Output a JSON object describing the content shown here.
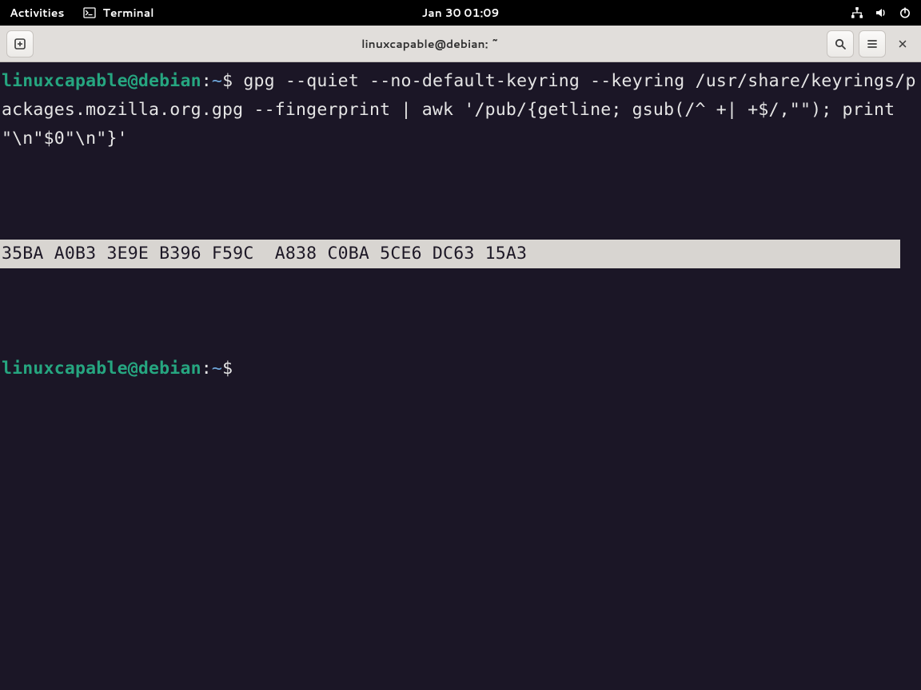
{
  "top_panel": {
    "activities": "Activities",
    "app_label": "Terminal",
    "clock": "Jan 30  01:09"
  },
  "titlebar": {
    "title": "linuxcapable@debian: ~"
  },
  "terminal": {
    "prompt_user": "linuxcapable@debian",
    "prompt_sep": ":",
    "prompt_path": "~",
    "prompt_symbol": "$",
    "command": "gpg --quiet --no-default-keyring --keyring /usr/share/keyrings/packages.mozilla.org.gpg --fingerprint | awk '/pub/{getline; gsub(/^ +| +$/,\"\"); print \"\\n\"$0\"\\n\"}'",
    "output_fingerprint": "35BA A0B3 3E9E B396 F59C  A838 C0BA 5CE6 DC63 15A3"
  }
}
